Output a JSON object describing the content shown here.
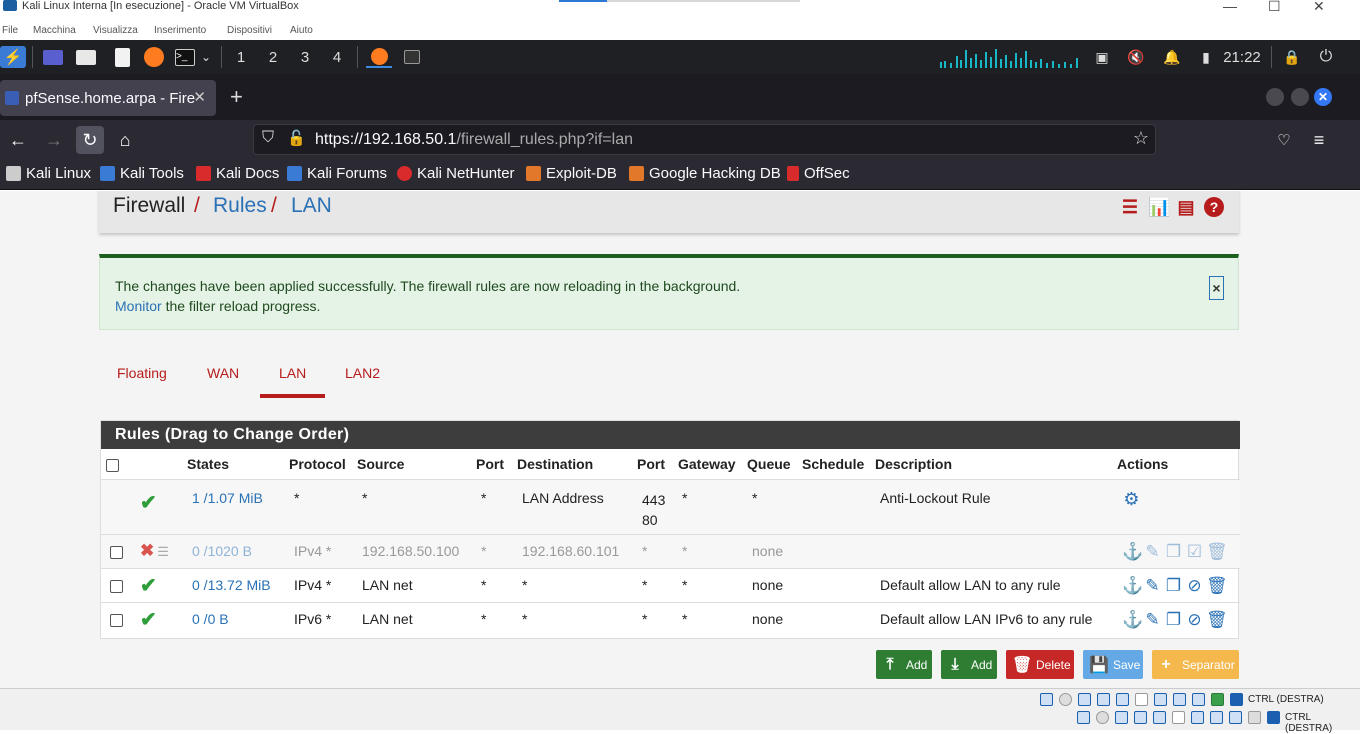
{
  "window": {
    "title": "Kali Linux Interna [In esecuzione] - Oracle VM VirtualBox",
    "menu": [
      "File",
      "Macchina",
      "Visualizza",
      "Inserimento",
      "Dispositivi",
      "Aiuto"
    ]
  },
  "panel": {
    "workspaces": [
      "1",
      "2",
      "3",
      "4"
    ],
    "clock": "21:22"
  },
  "browser": {
    "tab_title": "pfSense.home.arpa - Fire",
    "url_host": "https://192.168.50.1",
    "url_path": "/firewall_rules.php?if=lan",
    "bookmarks": [
      "Kali Linux",
      "Kali Tools",
      "Kali Docs",
      "Kali Forums",
      "Kali NetHunter",
      "Exploit-DB",
      "Google Hacking DB",
      "OffSec"
    ]
  },
  "breadcrumb": {
    "head": "Firewall",
    "sep": "/",
    "rules": "Rules",
    "lan": "LAN"
  },
  "alert": {
    "line1": "The changes have been applied successfully. The firewall rules are now reloading in the background.",
    "monitor_link": "Monitor",
    "line2_rest": " the filter reload progress.",
    "close": "×"
  },
  "tabs": [
    "Floating",
    "WAN",
    "LAN",
    "LAN2"
  ],
  "active_tab": "LAN",
  "rules_panel": {
    "title": "Rules (Drag to Change Order)",
    "headers": [
      "States",
      "Protocol",
      "Source",
      "Port",
      "Destination",
      "Port",
      "Gateway",
      "Queue",
      "Schedule",
      "Description",
      "Actions"
    ],
    "rows": [
      {
        "states": "1 /1.07 MiB",
        "protocol": "*",
        "source": "*",
        "sport": "*",
        "destination": "LAN Address",
        "dport1": "443",
        "dport2": "80",
        "gateway": "*",
        "queue": "*",
        "schedule": "",
        "description": "Anti-Lockout Rule"
      },
      {
        "states": "0 /1020 B",
        "protocol": "IPv4 *",
        "source": "192.168.50.100",
        "sport": "*",
        "destination": "192.168.60.101",
        "dport1": "*",
        "dport2": "",
        "gateway": "*",
        "queue": "none",
        "schedule": "",
        "description": ""
      },
      {
        "states": "0 /13.72 MiB",
        "protocol": "IPv4 *",
        "source": "LAN net",
        "sport": "*",
        "destination": "*",
        "dport1": "*",
        "dport2": "",
        "gateway": "*",
        "queue": "none",
        "schedule": "",
        "description": "Default allow LAN to any rule"
      },
      {
        "states": "0 /0 B",
        "protocol": "IPv6 *",
        "source": "LAN net",
        "sport": "*",
        "destination": "*",
        "dport1": "*",
        "dport2": "",
        "gateway": "*",
        "queue": "none",
        "schedule": "",
        "description": "Default allow LAN IPv6 to any rule"
      }
    ]
  },
  "buttons": {
    "add_top": "Add",
    "add_bottom": "Add",
    "delete": "Delete",
    "save": "Save",
    "separator": "Separator"
  },
  "vbox_status": {
    "host_key": "CTRL (DESTRA)"
  },
  "colors": {
    "pfsense_red": "#b71c1c",
    "link_blue": "#2a71b5",
    "success_green": "#2e9d3a"
  }
}
